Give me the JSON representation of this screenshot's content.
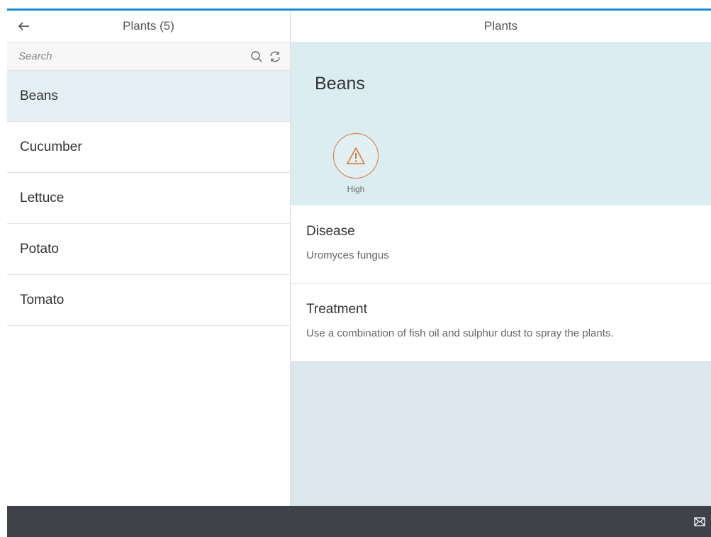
{
  "master": {
    "title": "Plants (5)",
    "back_icon": "arrow-left-icon",
    "search": {
      "placeholder": "Search",
      "value": ""
    },
    "items": [
      {
        "label": "Beans",
        "selected": true
      },
      {
        "label": "Cucumber",
        "selected": false
      },
      {
        "label": "Lettuce",
        "selected": false
      },
      {
        "label": "Potato",
        "selected": false
      },
      {
        "label": "Tomato",
        "selected": false
      }
    ]
  },
  "detail": {
    "title": "Plants",
    "object": {
      "title": "Beans",
      "status_icon": "warning-icon",
      "status_label": "High",
      "status_color": "#d47a3b"
    },
    "sections": {
      "disease": {
        "title": "Disease",
        "text": "Uromyces fungus"
      },
      "treatment": {
        "title": "Treatment",
        "text": "Use a combination of fish oil and sulphur dust to spray the plants."
      }
    },
    "footer_icon": "email-icon"
  },
  "colors": {
    "accent": "#1a8cd8",
    "footer": "#3f4248",
    "selected_row": "#e5f0f6",
    "object_header_bg": "#dcedf2"
  }
}
